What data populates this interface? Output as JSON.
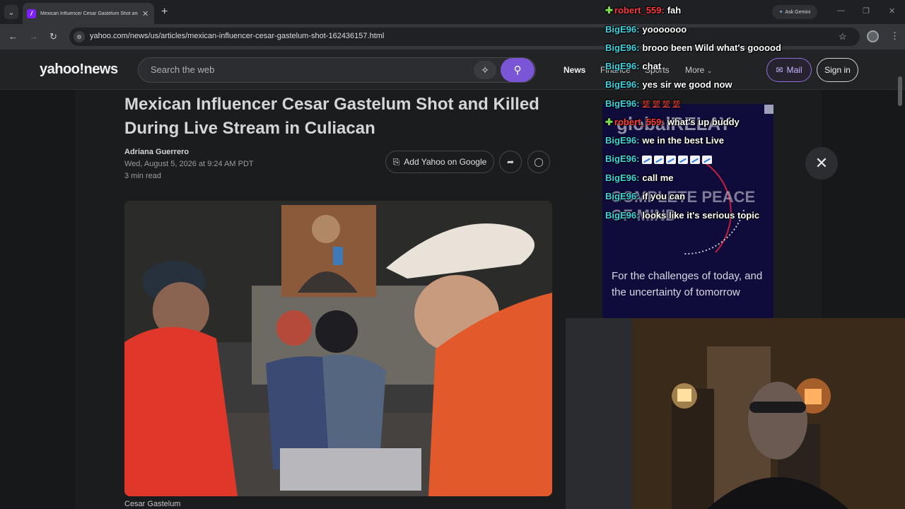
{
  "browser": {
    "tab_title": "Mexican Influencer Cesar Gastelum Shot and Killed Du",
    "favicon_letter": "/",
    "new_tab": "+",
    "gemini_label": "Ask Gemini",
    "url": "yahoo.com/news/us/articles/mexican-influencer-cesar-gastelum-shot-162436157.html"
  },
  "header": {
    "logo": "yahoo!news",
    "search_placeholder": "Search the web",
    "nav": [
      "News",
      "Finance",
      "Sports",
      "More"
    ],
    "mail_label": "Mail",
    "signin_label": "Sign in"
  },
  "article": {
    "headline": "Mexican Influencer Cesar Gastelum Shot and Killed During Live Stream in Culiacan",
    "author": "Adriana Guerrero",
    "date": "Wed, August 5, 2026 at 9:24 AM PDT",
    "read_time": "3 min read",
    "add_google_label": "Add Yahoo on Google",
    "caption": "Cesar Gastelum"
  },
  "ad": {
    "brand": "globalRELAY",
    "headline": "COMPLETE PEACE OF MIND",
    "body": "For the challenges of today, and the uncertainty of tomorrow"
  },
  "chat": {
    "messages": [
      {
        "user": "robert_559:",
        "text": "fah",
        "color": "#ff3b3b",
        "badge": true
      },
      {
        "user": "BigE96:",
        "text": "yooooooo",
        "color": "#3fd3e0"
      },
      {
        "user": "BigE96:",
        "text": "brooo been Wild what's gooood",
        "color": "#3fd3e0"
      },
      {
        "user": "BigE96:",
        "text": "chat",
        "color": "#3fd3e0"
      },
      {
        "user": "BigE96:",
        "text": "yes sir we good now",
        "color": "#3fd3e0"
      },
      {
        "user": "BigE96:",
        "text": "",
        "color": "#3fd3e0",
        "emotes": "100"
      },
      {
        "user": "robert_559:",
        "text": "what's up buddy",
        "color": "#ff3b3b",
        "badge": true
      },
      {
        "user": "BigE96:",
        "text": "we in the best Live",
        "color": "#3fd3e0"
      },
      {
        "user": "BigE96:",
        "text": "",
        "color": "#3fd3e0",
        "emotes": "chart"
      },
      {
        "user": "BigE96:",
        "text": "call me",
        "color": "#3fd3e0"
      },
      {
        "user": "BigE96:",
        "text": "if you can",
        "color": "#3fd3e0"
      },
      {
        "user": "BigE96:",
        "text": "looks like it's serious topic",
        "color": "#3fd3e0"
      }
    ]
  }
}
